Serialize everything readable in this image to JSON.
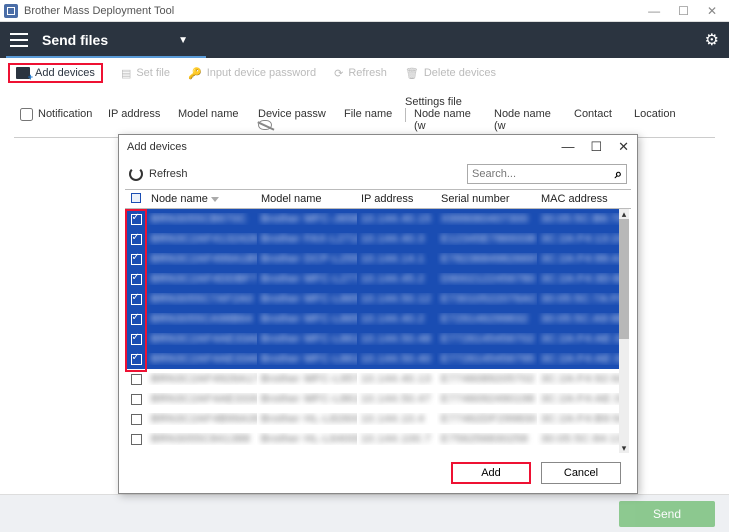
{
  "window": {
    "title": "Brother Mass Deployment Tool"
  },
  "topbar": {
    "title": "Send files"
  },
  "toolbar": {
    "add_devices": "Add devices",
    "set_file": "Set file",
    "input_password": "Input device password",
    "refresh": "Refresh",
    "delete_devices": "Delete devices"
  },
  "grid_headers": {
    "notification": "Notification",
    "ip": "IP address",
    "model": "Model name",
    "devpw": "Device passw",
    "settings_file": "Settings file",
    "file_name": "File name",
    "node_name_w1": "Node name (w",
    "node_name_w2": "Node name (w",
    "contact": "Contact",
    "location": "Location"
  },
  "dialog": {
    "title": "Add devices",
    "refresh": "Refresh",
    "search_placeholder": "Search...",
    "columns": {
      "node": "Node name",
      "model": "Model name",
      "ip": "IP address",
      "serial": "Serial number",
      "mac": "MAC address"
    },
    "rows": [
      {
        "sel": true,
        "node": "BRN3055CB670C",
        "model": "Brother MFC-J6580",
        "ip": "10.144.40.15",
        "serial": "X999060407300",
        "mac": "30:05:5C:B6:70:0C"
      },
      {
        "sel": true,
        "node": "BRN3C2AF4132426",
        "model": "Brother FAX-L2710",
        "ip": "10.144.40.3",
        "serial": "E12345E7869338",
        "mac": "3C:2A:F4:13:24:26"
      },
      {
        "sel": true,
        "node": "BRN3C2AF499A1B5",
        "model": "Brother DCP-L2550",
        "ip": "10.144.14.1",
        "serial": "E78236849826697",
        "mac": "3C:2A:F4:99:A1:B5"
      },
      {
        "sel": true,
        "node": "BRN3C2AF4DDBF7",
        "model": "Brother MFC-L2770",
        "ip": "10.144.45.2",
        "serial": "D9002122456780",
        "mac": "3C:2A:F4:3D:BA:F7"
      },
      {
        "sel": true,
        "node": "BRN3055C7AF2A0",
        "model": "Brother MFC-L8650",
        "ip": "10.144.50.12",
        "serial": "E73010522076AC",
        "mac": "30:05:5C:7A:F0:A0"
      },
      {
        "sel": true,
        "node": "BRN3055CA98B64",
        "model": "Brother MFC-L8650",
        "ip": "10.144.40.2",
        "serial": "E729146299832",
        "mac": "30:05:5C:A9:8B:64"
      },
      {
        "sel": true,
        "node": "BRN3C2AF4AE33AD",
        "model": "Brother MFC-L8610",
        "ip": "10.144.50.48",
        "serial": "E7726145456702",
        "mac": "3C:2A:F4:AE:33:AD"
      },
      {
        "sel": true,
        "node": "BRN3C2AF4AE3340",
        "model": "Brother MFC-L8610",
        "ip": "10.144.50.40",
        "serial": "E7726145456795",
        "mac": "3C:2A:F4:AE:33:40"
      },
      {
        "sel": false,
        "node": "BRN3C2AF4926A17",
        "model": "Brother MFC-L9570",
        "ip": "10.144.40.13",
        "serial": "E7746089205702",
        "mac": "3C:2A:F4:92:6A:17"
      },
      {
        "sel": false,
        "node": "BRN3C2AF4AE333C",
        "model": "Brother MFC-L8610",
        "ip": "10.144.50.47",
        "serial": "E7746092490198",
        "mac": "3C:2A:F4:AE:33:3C"
      },
      {
        "sel": false,
        "node": "BRN3C2AF4B99A39",
        "model": "Brother HL-L8260C",
        "ip": "10.144.10.4",
        "serial": "E77462DF299830",
        "mac": "3C:2A:F4:B9:9A:39"
      },
      {
        "sel": false,
        "node": "BRN3055C841388",
        "model": "Brother HL-L6400D",
        "ip": "10.144.100.7",
        "serial": "E756256830258",
        "mac": "30:05:5C:84:13:88"
      }
    ],
    "add": "Add",
    "cancel": "Cancel"
  },
  "footer": {
    "send": "Send"
  }
}
